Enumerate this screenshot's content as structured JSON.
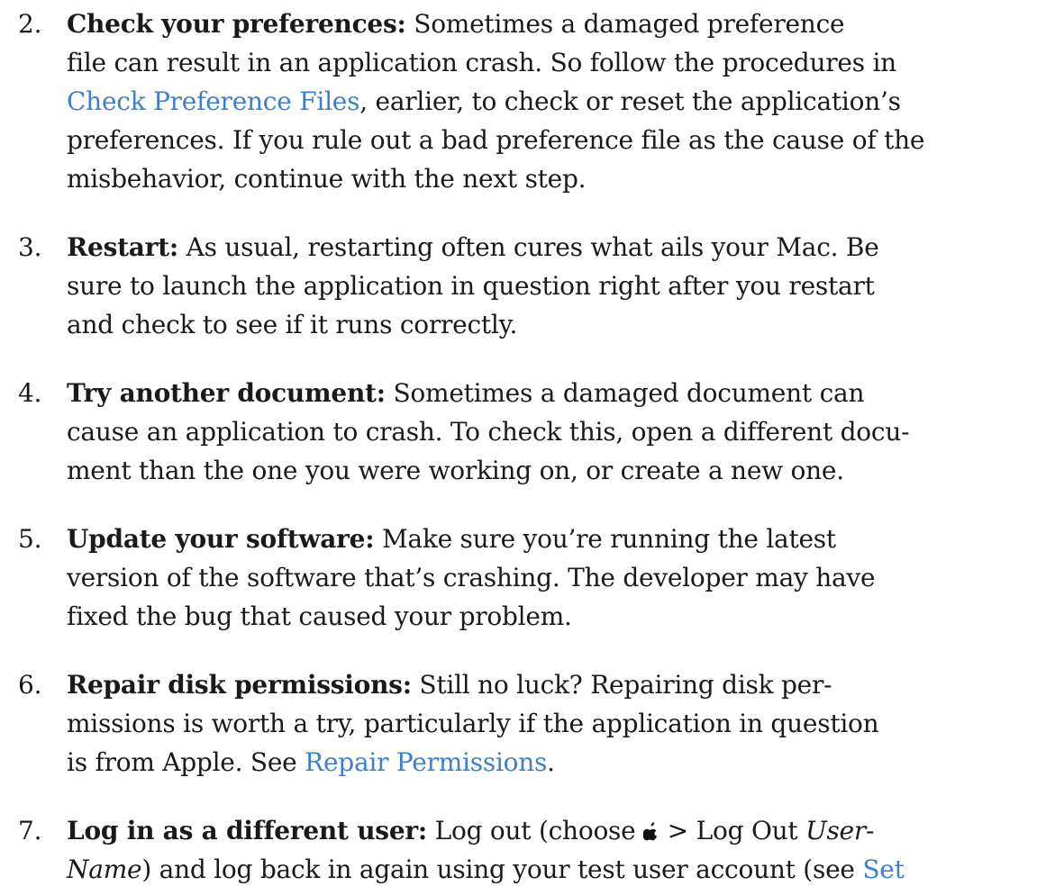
{
  "steps": [
    {
      "number": "2.",
      "lead": "Check your preferences:",
      "l1": " Sometimes a damaged preference",
      "l2": "file can result in an application crash. So follow the procedures in",
      "link1": "Check Preference Files",
      "l3_after": ", earlier, to check or reset the application’s",
      "l4": "preferences. If you rule out a bad preference file as the cause of the",
      "l5": "misbehavior, continue with the next step."
    },
    {
      "number": "3.",
      "lead": "Restart:",
      "l1": " As usual, restarting often cures what ails your Mac. Be",
      "l2": "sure to launch the application in question right after you restart",
      "l3": "and check to see if it runs correctly."
    },
    {
      "number": "4.",
      "lead": "Try another document:",
      "l1": " Sometimes a damaged document can",
      "l2": "cause an application to crash. To check this, open a different docu-",
      "l3": "ment than the one you were working on, or create a new one."
    },
    {
      "number": "5.",
      "lead": "Update your software:",
      "l1": " Make sure you’re running the latest",
      "l2": "version of the software that’s crashing. The developer may have",
      "l3": "fixed the bug that caused your problem."
    },
    {
      "number": "6.",
      "lead": "Repair disk permissions:",
      "l1": " Still no luck? Repairing disk per-",
      "l2": "missions is worth a try, particularly if the application in question",
      "l3_before": "is from Apple. See ",
      "link1": "Repair Permissions",
      "l3_after": "."
    },
    {
      "number": "7.",
      "lead": "Log in as a different user:",
      "l1_before": " Log out (choose ",
      "apple_icon": "apple-menu-icon",
      "l1_mid": " > Log Out ",
      "l1_italic": "User-",
      "l2_italic": "Name",
      "l2_after": ") and log back in again using your test user account (see ",
      "link1": "Set"
    }
  ]
}
